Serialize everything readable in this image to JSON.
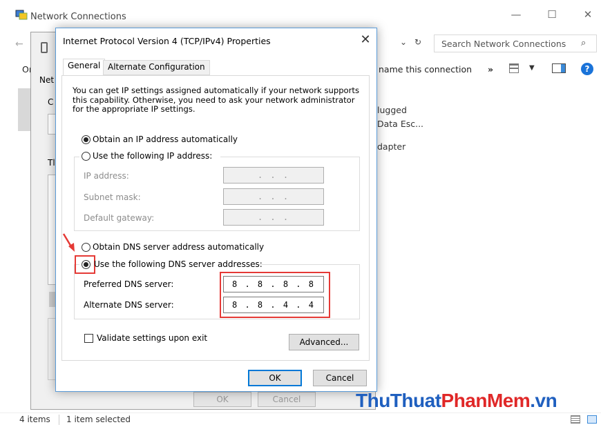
{
  "explorer": {
    "title": "Network Connections",
    "search_placeholder": "Search Network Connections",
    "cmd_rename": "name this connection",
    "cmd_more": "»",
    "partial_text": {
      "left_or": "Or",
      "status_1": "lugged",
      "status_2": "Data Esc...",
      "adapter": "dapter"
    },
    "status": {
      "items": "4 items",
      "selected": "1 item selected"
    }
  },
  "behind_dialog": {
    "tab_partial": "Net",
    "text_c": "C",
    "text_th": "Tl",
    "ok_label": "OK",
    "cancel_label": "Cancel"
  },
  "dialog": {
    "title": "Internet Protocol Version 4 (TCP/IPv4) Properties",
    "tabs": [
      "General",
      "Alternate Configuration"
    ],
    "intro": "You can get IP settings assigned automatically if your network supports this capability. Otherwise, you need to ask your network administrator for the appropriate IP settings.",
    "ip_auto_label": "Obtain an IP address automatically",
    "ip_manual_label": "Use the following IP address:",
    "ip_fields": [
      {
        "label": "IP address:",
        "value": ".  .  ."
      },
      {
        "label": "Subnet mask:",
        "value": ".  .  ."
      },
      {
        "label": "Default gateway:",
        "value": ".  .  ."
      }
    ],
    "dns_auto_label": "Obtain DNS server address automatically",
    "dns_manual_label": "Use the following DNS server addresses:",
    "dns_fields": [
      {
        "label": "Preferred DNS server:",
        "value": "8 . 8 . 8 . 8"
      },
      {
        "label": "Alternate DNS server:",
        "value": "8 . 8 . 4 . 4"
      }
    ],
    "validate_label": "Validate settings upon exit",
    "advanced_label": "Advanced...",
    "ok_label": "OK",
    "cancel_label": "Cancel"
  },
  "watermark": {
    "part1": "ThuThuat",
    "part2": "PhanMem",
    "part3": ".vn"
  },
  "colors": {
    "accent": "#0078d7",
    "highlight": "#e53935",
    "wm_blue": "#1f5fbf",
    "wm_red": "#e02828"
  }
}
